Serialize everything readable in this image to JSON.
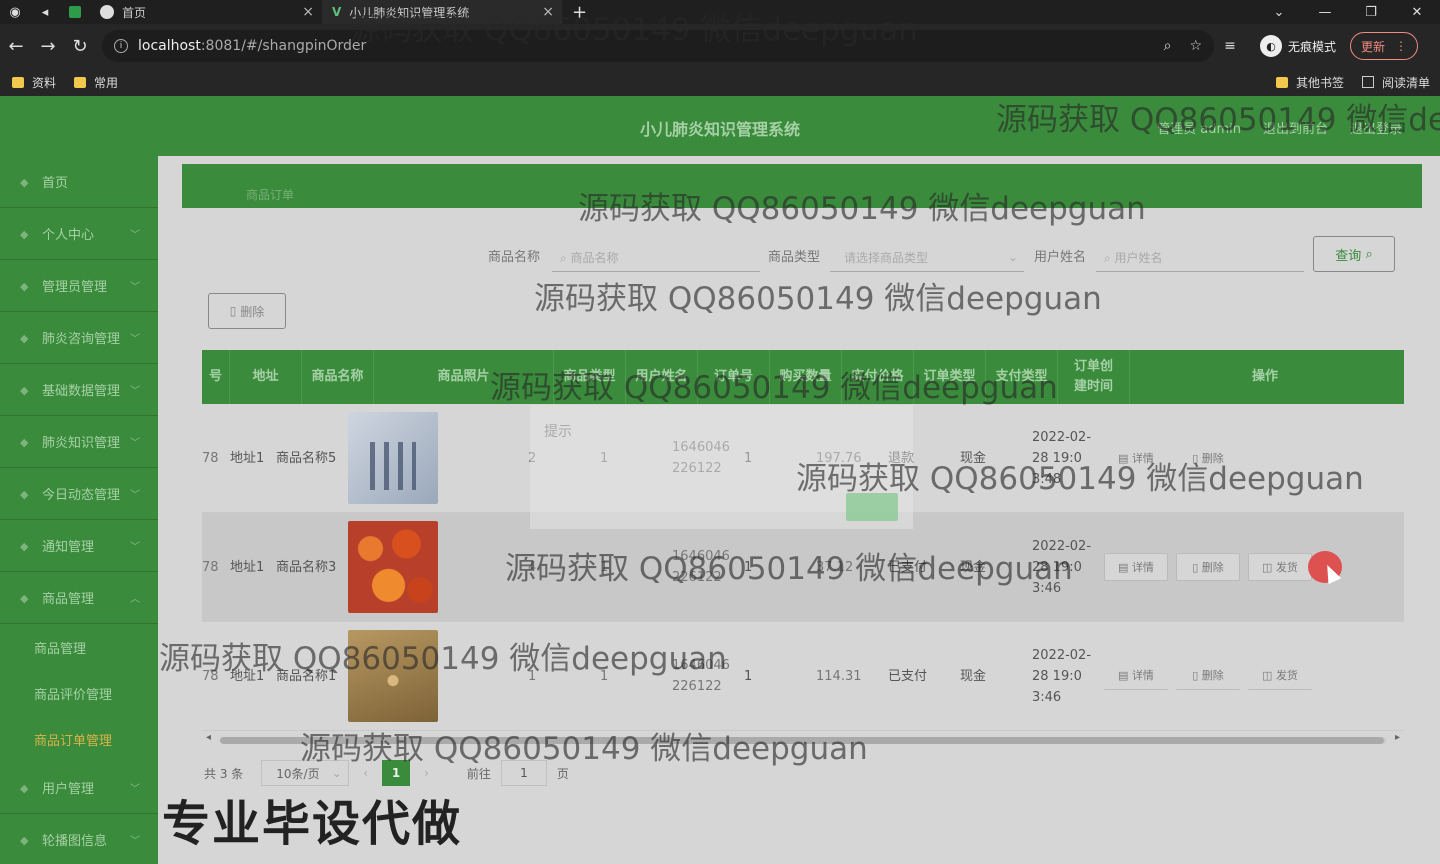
{
  "browser": {
    "tabs": [
      {
        "label": "首页"
      },
      {
        "label": "小儿肺炎知识管理系统"
      }
    ],
    "url_host": "localhost",
    "url_path": ":8081/#/shangpinOrder",
    "incognito_label": "无痕模式",
    "update_label": "更新",
    "bookmarks": [
      "资料",
      "常用"
    ],
    "bookmarks_right": [
      "其他书签",
      "阅读清单"
    ]
  },
  "header": {
    "title": "小儿肺炎知识管理系统",
    "links": [
      "管理员 admin",
      "退出到前台",
      "退出登录"
    ]
  },
  "sidebar": {
    "items": [
      {
        "label": "首页",
        "expandable": false
      },
      {
        "label": "个人中心",
        "expandable": true
      },
      {
        "label": "管理员管理",
        "expandable": true
      },
      {
        "label": "肺炎咨询管理",
        "expandable": true
      },
      {
        "label": "基础数据管理",
        "expandable": true
      },
      {
        "label": "肺炎知识管理",
        "expandable": true
      },
      {
        "label": "今日动态管理",
        "expandable": true
      },
      {
        "label": "通知管理",
        "expandable": true
      },
      {
        "label": "商品管理",
        "expandable": true,
        "expanded": true
      }
    ],
    "sub_items": [
      "商品管理",
      "商品评价管理",
      "商品订单管理"
    ],
    "active_sub": "商品订单管理",
    "items_after": [
      "用户管理",
      "轮播图信息"
    ]
  },
  "breadcrumb": "商品订单",
  "search": {
    "fields": [
      {
        "label": "商品名称",
        "placeholder": "商品名称"
      },
      {
        "label": "商品类型",
        "placeholder": "请选择商品类型"
      },
      {
        "label": "用户姓名",
        "placeholder": "用户姓名"
      }
    ],
    "button_label": "查询"
  },
  "delete_button": "删除",
  "table": {
    "columns": [
      "地址",
      "商品名称",
      "商品照片",
      "商品类型",
      "用户姓名",
      "订单号",
      "购买数量",
      "实付价格",
      "订单类型",
      "支付类型",
      "订单创建时间",
      "操作"
    ],
    "rows": [
      {
        "id_frag": "78",
        "address": "地址1",
        "name": "商品名称5",
        "photo": "bottles",
        "type": "2",
        "user": "1",
        "order_no": "1646046226122",
        "qty": "1",
        "price": "197.76",
        "status": "退款",
        "pay": "现金",
        "created": "2022-02-28 19:03:48",
        "actions": [
          "详情",
          "删除"
        ]
      },
      {
        "id_frag": "78",
        "address": "地址1",
        "name": "商品名称3",
        "photo": "flowers",
        "type": "4",
        "user": "1",
        "order_no": "1646046226122",
        "qty": "1",
        "price": "37.12",
        "status": "已支付",
        "pay": "现金",
        "created": "2022-02-28 19:03:46",
        "actions": [
          "详情",
          "删除",
          "发货"
        ]
      },
      {
        "id_frag": "78",
        "address": "地址1",
        "name": "商品名称1",
        "photo": "brown",
        "type": "1",
        "user": "1",
        "order_no": "1646046226122",
        "qty": "1",
        "price": "114.31",
        "status": "已支付",
        "pay": "现金",
        "created": "2022-02-28 19:03:46",
        "actions": [
          "详情",
          "删除",
          "发货"
        ]
      }
    ]
  },
  "pagination": {
    "total": "共 3 条",
    "page_size": "10条/页",
    "current_page": "1",
    "goto_label": "前往",
    "goto_value": "1",
    "goto_suffix": "页"
  },
  "ghost_dialog": {
    "title": "提示"
  },
  "watermark": "源码获取 QQ86050149 微信deepguan",
  "promo": "专业毕设代做"
}
